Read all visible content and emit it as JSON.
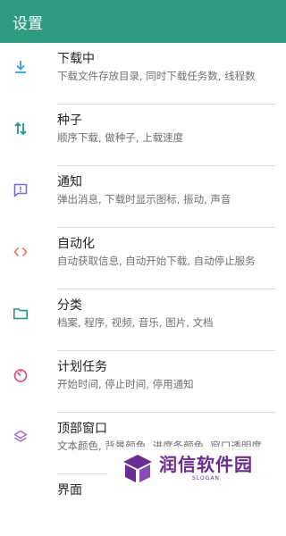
{
  "appbar": {
    "title": "设置"
  },
  "colors": {
    "appbar": "#2e9a82",
    "icon_download": "#3b9be0",
    "icon_seed": "#22958a",
    "icon_notify": "#7b6fd6",
    "icon_automation": "#e86e5a",
    "icon_category": "#22958a",
    "icon_schedule": "#e0457b",
    "icon_top_window": "#9c6bd8",
    "watermark": "#6a2c91"
  },
  "items": [
    {
      "icon": "download-icon",
      "label": "下载中",
      "desc": "下载文件存放目录, 同时下载任务数, 线程数"
    },
    {
      "icon": "swap-vertical-icon",
      "label": "种子",
      "desc": "顺序下载, 做种子, 上载速度"
    },
    {
      "icon": "notification-message-icon",
      "label": "通知",
      "desc": "弹出消息, 下载时显示图标, 振动, 声音"
    },
    {
      "icon": "code-brackets-icon",
      "label": "自动化",
      "desc": "自动获取信息, 自动开始下载, 自动停止服务"
    },
    {
      "icon": "folder-icon",
      "label": "分类",
      "desc": "档案, 程序, 视频, 音乐, 图片, 文档"
    },
    {
      "icon": "timer-icon",
      "label": "计划任务",
      "desc": "开始时间, 停止时间, 停用通知"
    },
    {
      "icon": "layers-icon",
      "label": "顶部窗口",
      "desc": "文本颜色, 背景颜色, 进度条颜色, 窗口透明度"
    },
    {
      "icon": "",
      "label": "界面",
      "desc": ""
    }
  ],
  "watermark": {
    "name": "润信软件园",
    "slogan": "SLOGAN"
  }
}
